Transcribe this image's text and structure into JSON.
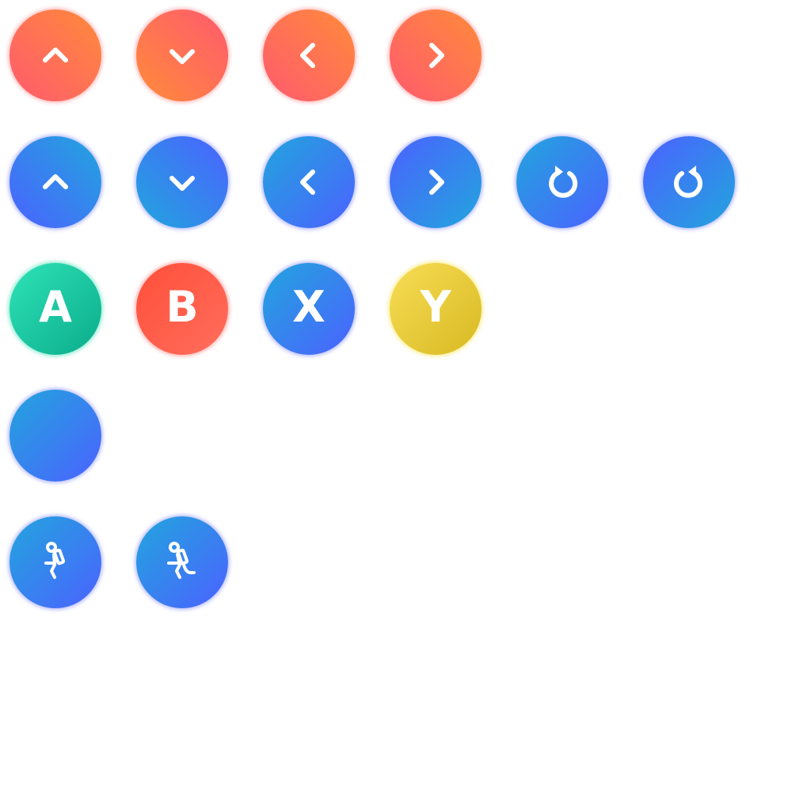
{
  "dpad_orange": {
    "up": {
      "icon": "chevron-up-icon"
    },
    "down": {
      "icon": "chevron-down-icon"
    },
    "left": {
      "icon": "chevron-left-icon"
    },
    "right": {
      "icon": "chevron-right-icon"
    }
  },
  "dpad_blue": {
    "up": {
      "icon": "chevron-up-icon"
    },
    "down": {
      "icon": "chevron-down-icon"
    },
    "left": {
      "icon": "chevron-left-icon"
    },
    "right": {
      "icon": "chevron-right-icon"
    },
    "rotate_left": {
      "icon": "rotate-ccw-icon"
    },
    "rotate_right": {
      "icon": "rotate-cw-icon"
    }
  },
  "face_buttons": {
    "a": {
      "label": "A",
      "color": "#1fcfa3"
    },
    "b": {
      "label": "B",
      "color": "#ff5a4a"
    },
    "x": {
      "label": "X",
      "color": "#3b82e8"
    },
    "y": {
      "label": "Y",
      "color": "#ecc93a"
    }
  },
  "blank_button": {
    "icon": "none"
  },
  "action_buttons": {
    "walk": {
      "icon": "hiker-walk-icon"
    },
    "run": {
      "icon": "hiker-run-icon"
    }
  },
  "colors": {
    "orange_start": "#ff5a6e",
    "orange_end": "#ff8b3a",
    "blue_start": "#22a5dd",
    "blue_end": "#4b62ff"
  }
}
